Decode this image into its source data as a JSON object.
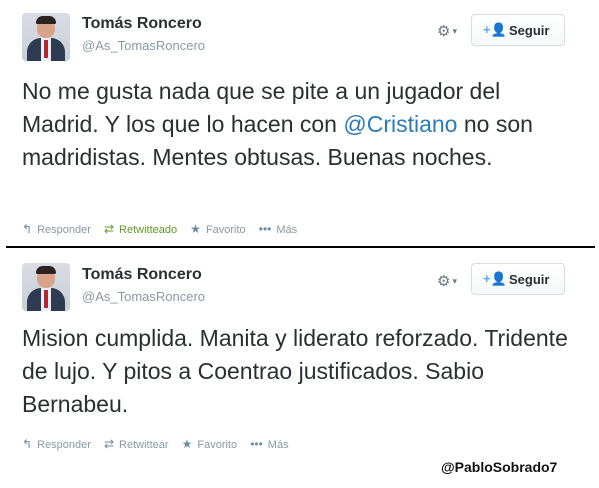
{
  "tweets": [
    {
      "name": "Tomás Roncero",
      "handle": "@As_TomasRoncero",
      "gear_icon": "gear-icon",
      "follow_label": "Seguir",
      "text_before": "No me gusta nada que se pite a un jugador del Madrid. Y los que lo hacen con ",
      "mention": "@Cristiano",
      "text_after": " no son madridistas. Mentes obtusas. Buenas noches.",
      "actions": {
        "reply": "Responder",
        "retweet": "Retwitteado",
        "favorite": "Favorito",
        "more": "Más"
      }
    },
    {
      "name": "Tomás Roncero",
      "handle": "@As_TomasRoncero",
      "gear_icon": "gear-icon",
      "follow_label": "Seguir",
      "text_before": "Mision cumplida. Manita y liderato reforzado. Tridente de lujo. Y pitos a Coentrao justificados. Sabio Bernabeu.",
      "mention": "",
      "text_after": "",
      "actions": {
        "reply": "Responder",
        "retweet": "Retwittear",
        "favorite": "Favorito",
        "more": "Más"
      }
    }
  ],
  "credit": "@PabloSobrado7",
  "colors": {
    "link": "#2b7bb9",
    "retweeted": "#609928",
    "follow_icon": "#55acee",
    "muted": "#8899a6"
  }
}
